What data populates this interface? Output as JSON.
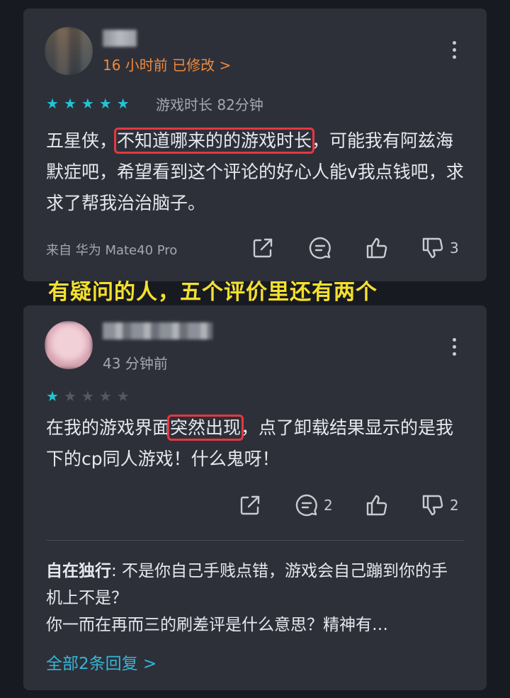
{
  "review1": {
    "time": "16 小时前 已修改 >",
    "rating": 5,
    "playtime": "游戏时长 82分钟",
    "text_before": "五星侠，",
    "text_highlight": "不知道哪来的的游戏时长",
    "text_after": "，可能我有阿兹海默症吧，希望看到这个评论的好心人能v我点钱吧，求求了帮我治治脑子。",
    "device": "来自 华为 Mate40 Pro",
    "dislike_count": "3"
  },
  "caption": "有疑问的人，五个评价里还有两个",
  "review2": {
    "time": "43 分钟前",
    "rating": 1,
    "text_before": "在我的游戏界面",
    "text_highlight": "突然出现",
    "text_after": "，点了卸载结果显示的是我下的cp同人游戏！什么鬼呀！",
    "comment_count": "2",
    "dislike_count": "2",
    "reply": {
      "author": "自在独行",
      "text": ": 不是你自己手贱点错，游戏会自己蹦到你的手机上不是？",
      "text2": "你一而在再而三的刷差评是什么意思？精神有…"
    },
    "more_replies": "全部2条回复 >"
  },
  "colors": {
    "accent_orange": "#f08a3c",
    "star_on": "#20c5d6",
    "highlight_box": "#e5383f",
    "caption_yellow": "#f4e02d",
    "link": "#35b6d6"
  }
}
